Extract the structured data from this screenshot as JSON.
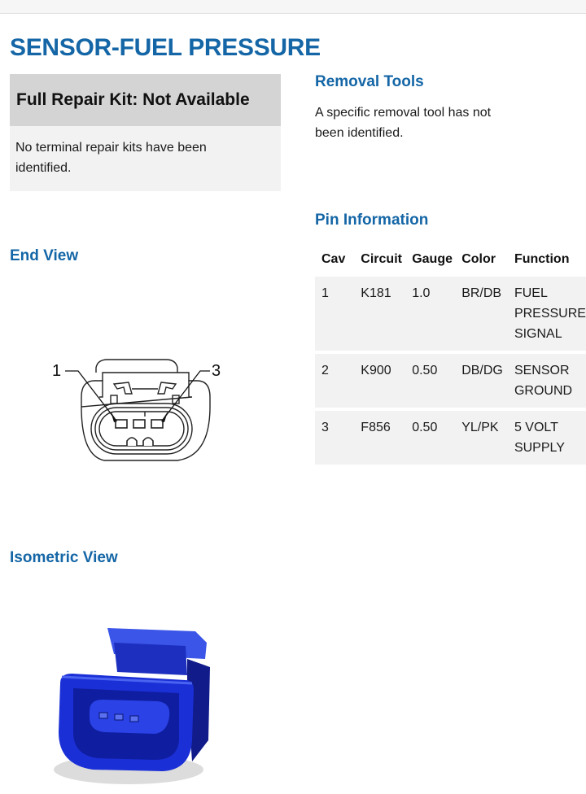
{
  "page": {
    "title": "SENSOR-FUEL PRESSURE"
  },
  "repair_kit": {
    "heading": "Full Repair Kit: Not Available",
    "body": "No terminal repair kits have been identified."
  },
  "removal_tools": {
    "heading": "Removal Tools",
    "body": "A specific removal tool has not been identified."
  },
  "pin_information": {
    "heading": "Pin Information",
    "columns": [
      "Cav",
      "Circuit",
      "Gauge",
      "Color",
      "Function"
    ],
    "rows": [
      {
        "cav": "1",
        "circuit": "K181",
        "gauge": "1.0",
        "color": "BR/DB",
        "function": "FUEL PRESSURE SIGNAL"
      },
      {
        "cav": "2",
        "circuit": "K900",
        "gauge": "0.50",
        "color": "DB/DG",
        "function": "SENSOR GROUND"
      },
      {
        "cav": "3",
        "circuit": "F856",
        "gauge": "0.50",
        "color": "YL/PK",
        "function": "5 VOLT SUPPLY"
      }
    ]
  },
  "end_view": {
    "heading": "End View",
    "label_left": "1",
    "label_right": "3"
  },
  "isometric_view": {
    "heading": "Isometric View"
  },
  "colors": {
    "heading_blue": "#1466a6",
    "connector_blue": "#1a2fd6"
  }
}
